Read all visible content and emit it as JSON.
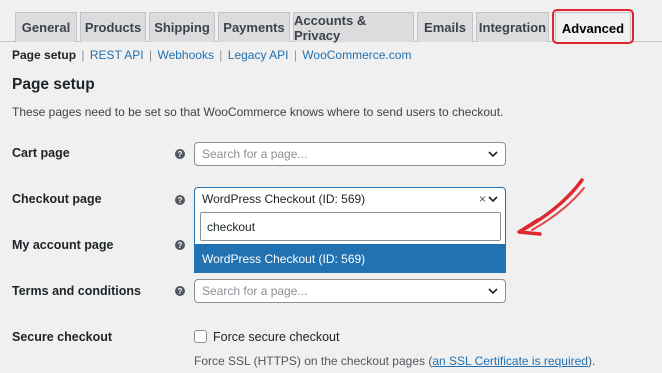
{
  "tabs": [
    {
      "label": "General"
    },
    {
      "label": "Products"
    },
    {
      "label": "Shipping"
    },
    {
      "label": "Payments"
    },
    {
      "label": "Accounts & Privacy"
    },
    {
      "label": "Emails"
    },
    {
      "label": "Integration"
    },
    {
      "label": "Advanced"
    }
  ],
  "active_tab": "Advanced",
  "subnav": {
    "current": "Page setup",
    "links": [
      "REST API",
      "Webhooks",
      "Legacy API",
      "WooCommerce.com"
    ],
    "separator": "|"
  },
  "section": {
    "title": "Page setup",
    "description": "These pages need to be set so that WooCommerce knows where to send users to checkout."
  },
  "rows": {
    "cart": {
      "label": "Cart page",
      "placeholder": "Search for a page..."
    },
    "checkout": {
      "label": "Checkout page",
      "value": "WordPress Checkout (ID: 569)",
      "clear": "×"
    },
    "myaccount": {
      "label": "My account page"
    },
    "terms": {
      "label": "Terms and conditions",
      "placeholder": "Search for a page..."
    },
    "secure": {
      "label": "Secure checkout",
      "checkbox_label": "Force secure checkout",
      "checked": false,
      "desc_before": "Force SSL (HTTPS) on the checkout pages (",
      "desc_link": "an SSL Certificate is required",
      "desc_after": ")."
    }
  },
  "dropdown": {
    "search_value": "checkout",
    "options": [
      "WordPress Checkout (ID: 569)"
    ]
  },
  "help_glyph": "?",
  "colors": {
    "accent": "#2271b1",
    "highlight": "#e0262f",
    "background": "#f0f0f1"
  }
}
